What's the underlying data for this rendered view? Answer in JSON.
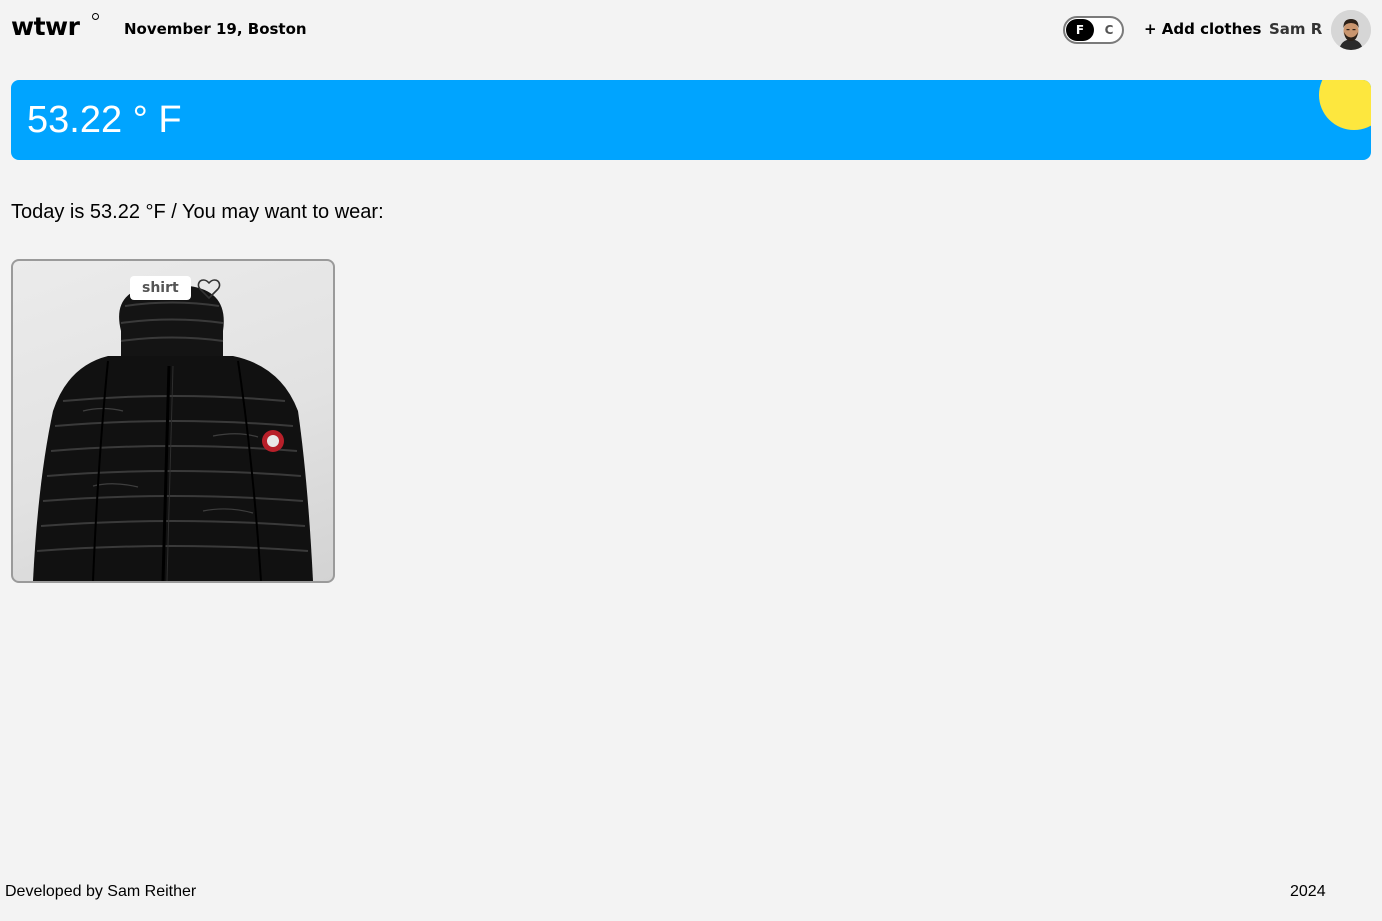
{
  "header": {
    "logo": "wtwr",
    "date_location": "November 19, Boston",
    "temp_toggle": {
      "f_label": "F",
      "c_label": "C",
      "selected": "F"
    },
    "add_clothes_label": "+ Add clothes",
    "username": "Sam R"
  },
  "weather": {
    "temperature": "53.22 ° F",
    "condition_icon": "sun-icon",
    "card_color": "#00a4ff",
    "sun_color": "#fde73e"
  },
  "main": {
    "recommendation": "Today is 53.22 °F / You may want to wear:",
    "items": [
      {
        "name": "shirt",
        "icon": "heart-icon",
        "liked": false
      }
    ]
  },
  "footer": {
    "developer": "Developed by Sam Reither",
    "year": "2024"
  }
}
